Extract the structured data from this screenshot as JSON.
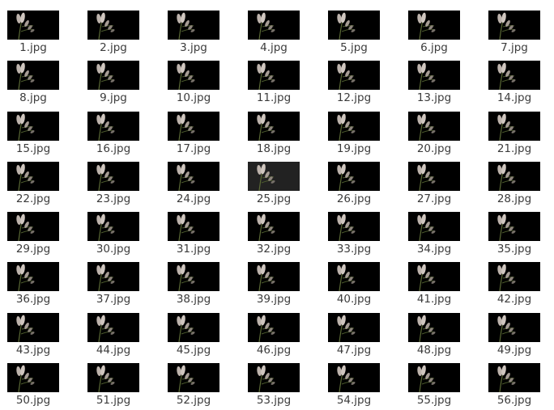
{
  "files": [
    {
      "name": "1.jpg"
    },
    {
      "name": "2.jpg"
    },
    {
      "name": "3.jpg"
    },
    {
      "name": "4.jpg"
    },
    {
      "name": "5.jpg"
    },
    {
      "name": "6.jpg"
    },
    {
      "name": "7.jpg"
    },
    {
      "name": "8.jpg"
    },
    {
      "name": "9.jpg"
    },
    {
      "name": "10.jpg"
    },
    {
      "name": "11.jpg"
    },
    {
      "name": "12.jpg"
    },
    {
      "name": "13.jpg"
    },
    {
      "name": "14.jpg"
    },
    {
      "name": "15.jpg"
    },
    {
      "name": "16.jpg"
    },
    {
      "name": "17.jpg"
    },
    {
      "name": "18.jpg"
    },
    {
      "name": "19.jpg"
    },
    {
      "name": "20.jpg"
    },
    {
      "name": "21.jpg"
    },
    {
      "name": "22.jpg"
    },
    {
      "name": "23.jpg"
    },
    {
      "name": "24.jpg"
    },
    {
      "name": "25.jpg",
      "selected": true
    },
    {
      "name": "26.jpg"
    },
    {
      "name": "27.jpg"
    },
    {
      "name": "28.jpg"
    },
    {
      "name": "29.jpg"
    },
    {
      "name": "30.jpg"
    },
    {
      "name": "31.jpg"
    },
    {
      "name": "32.jpg"
    },
    {
      "name": "33.jpg"
    },
    {
      "name": "34.jpg"
    },
    {
      "name": "35.jpg"
    },
    {
      "name": "36.jpg"
    },
    {
      "name": "37.jpg"
    },
    {
      "name": "38.jpg"
    },
    {
      "name": "39.jpg"
    },
    {
      "name": "40.jpg"
    },
    {
      "name": "41.jpg"
    },
    {
      "name": "42.jpg"
    },
    {
      "name": "43.jpg"
    },
    {
      "name": "44.jpg"
    },
    {
      "name": "45.jpg"
    },
    {
      "name": "46.jpg"
    },
    {
      "name": "47.jpg"
    },
    {
      "name": "48.jpg"
    },
    {
      "name": "49.jpg"
    },
    {
      "name": "50.jpg"
    },
    {
      "name": "51.jpg"
    },
    {
      "name": "52.jpg"
    },
    {
      "name": "53.jpg"
    },
    {
      "name": "54.jpg"
    },
    {
      "name": "55.jpg"
    },
    {
      "name": "56.jpg"
    }
  ],
  "colors": {
    "thumbnail_background": "#000000",
    "selected_thumbnail_background": "#222222",
    "label_text": "#3c3c3c"
  }
}
